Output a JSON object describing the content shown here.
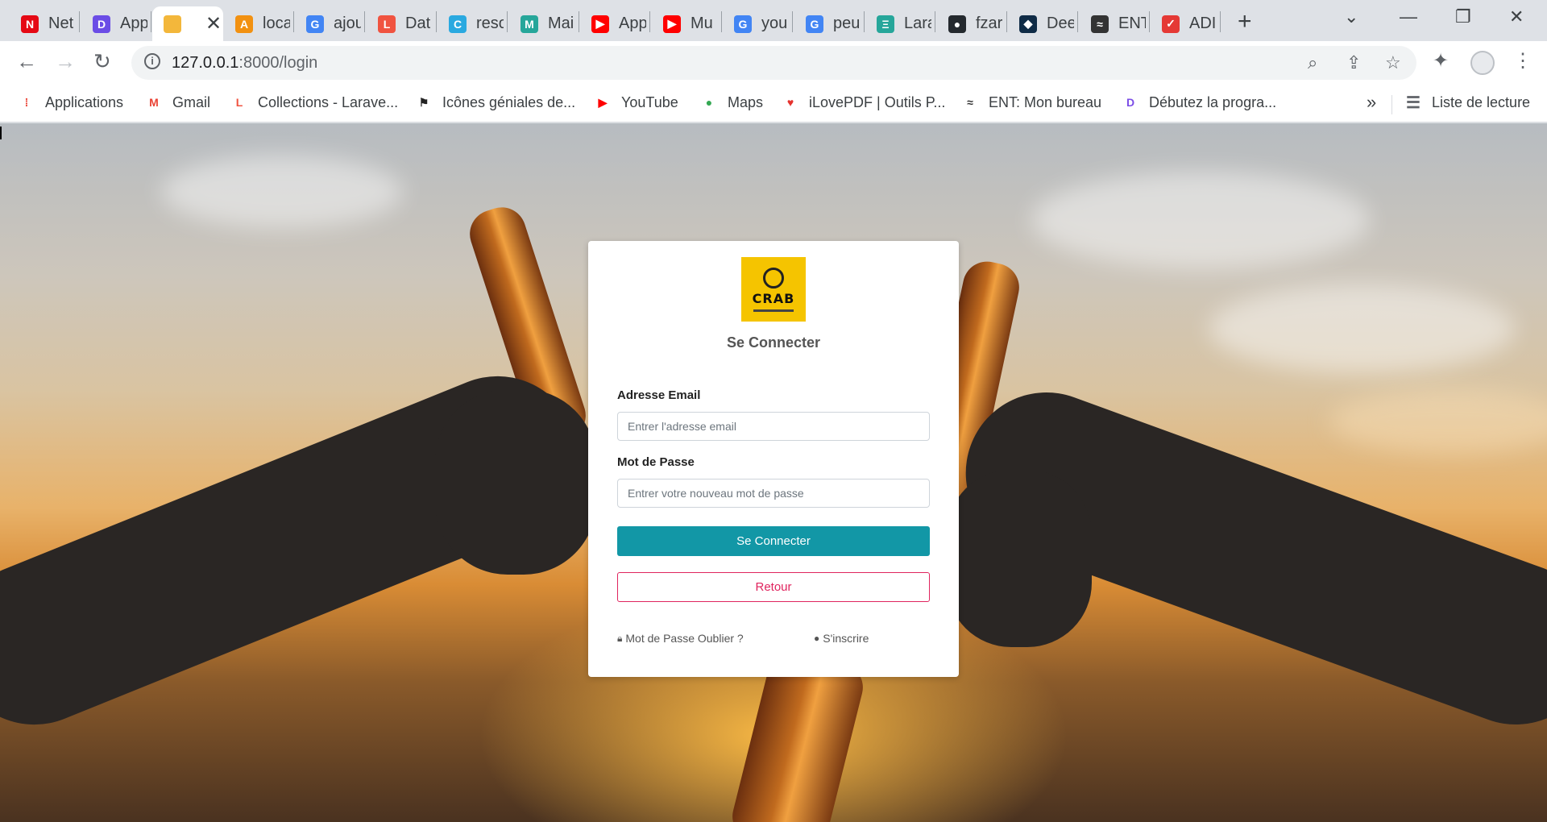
{
  "browser": {
    "tabs": [
      {
        "title": "Net",
        "icon": "netflix-icon",
        "color": "#e50914",
        "glyph": "N"
      },
      {
        "title": "App",
        "icon": "app-d-icon",
        "color": "#6b4de6",
        "glyph": "D"
      },
      {
        "title": "",
        "icon": "beer-icon",
        "color": "#f3b73b",
        "glyph": ""
      },
      {
        "title": "loca",
        "icon": "phpmyadmin-icon",
        "color": "#f29111",
        "glyph": "A"
      },
      {
        "title": "ajou",
        "icon": "google-icon",
        "color": "#4285f4",
        "glyph": "G"
      },
      {
        "title": "Dat",
        "icon": "laravel-icon",
        "color": "#f05340",
        "glyph": "L"
      },
      {
        "title": "reso",
        "icon": "c-icon",
        "color": "#2aa9e0",
        "glyph": "C"
      },
      {
        "title": "Mai",
        "icon": "mail-m-icon",
        "color": "#26a69a",
        "glyph": "M"
      },
      {
        "title": "App",
        "icon": "youtube-icon",
        "color": "#ff0000",
        "glyph": "▶"
      },
      {
        "title": "Mu",
        "icon": "youtube-icon",
        "color": "#ff0000",
        "glyph": "▶"
      },
      {
        "title": "you",
        "icon": "google-icon",
        "color": "#4285f4",
        "glyph": "G"
      },
      {
        "title": "peu",
        "icon": "google-icon",
        "color": "#4285f4",
        "glyph": "G"
      },
      {
        "title": "Lara",
        "icon": "laragon-icon",
        "color": "#26a69a",
        "glyph": "Ξ"
      },
      {
        "title": "fzar",
        "icon": "github-icon",
        "color": "#24292e",
        "glyph": "●"
      },
      {
        "title": "Dee",
        "icon": "deepl-icon",
        "color": "#0f2b46",
        "glyph": "◆"
      },
      {
        "title": "ENT",
        "icon": "ent-icon",
        "color": "#333333",
        "glyph": "≈"
      },
      {
        "title": "ADI",
        "icon": "adi-icon",
        "color": "#e53935",
        "glyph": "✓"
      }
    ],
    "url_host": "127.0.0.1",
    "url_path": ":8000/login",
    "bookmarks": [
      {
        "label": "Applications",
        "icon": "apps-grid-icon",
        "color": "#ea4335",
        "glyph": "⁞"
      },
      {
        "label": "Gmail",
        "icon": "gmail-icon",
        "color": "#ea4335",
        "glyph": "M"
      },
      {
        "label": "Collections - Larave...",
        "icon": "laravel-icon",
        "color": "#f05340",
        "glyph": "L"
      },
      {
        "label": "Icônes géniales de...",
        "icon": "fontawesome-flag-icon",
        "color": "#222222",
        "glyph": "⚑"
      },
      {
        "label": "YouTube",
        "icon": "youtube-icon",
        "color": "#ff0000",
        "glyph": "▶"
      },
      {
        "label": "Maps",
        "icon": "maps-icon",
        "color": "#34a853",
        "glyph": "●"
      },
      {
        "label": "iLovePDF | Outils P...",
        "icon": "ilovepdf-icon",
        "color": "#e5322d",
        "glyph": "♥"
      },
      {
        "label": "ENT: Mon bureau",
        "icon": "ent-icon",
        "color": "#333333",
        "glyph": "≈"
      },
      {
        "label": "Débutez la progra...",
        "icon": "app-d-icon",
        "color": "#7b4de6",
        "glyph": "D"
      }
    ],
    "more_glyph": "»",
    "reading_list": "Liste de lecture"
  },
  "login": {
    "logo_text": "CRAB",
    "title": "Se Connecter",
    "email_label": "Adresse Email",
    "email_placeholder": "Entrer l'adresse email",
    "password_label": "Mot de Passe",
    "password_placeholder": "Entrer votre nouveau mot de passe",
    "submit_label": "Se Connecter",
    "back_label": "Retour",
    "forgot_label": "Mot de Passe Oublier ?",
    "signup_label": "S'inscrire"
  }
}
